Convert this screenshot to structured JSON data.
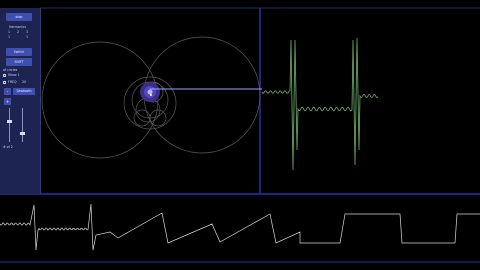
{
  "panel": {
    "top_button": "stop",
    "harmonics_label": "Harmonics",
    "digits_row_1": [
      "1",
      "2",
      "3"
    ],
    "digits_row_2": [
      "1",
      "1"
    ],
    "button_2": "Switch Waveform",
    "button_3": "SHIFT",
    "options_label": "of circles",
    "checkbox_label": "Show 1",
    "freq_label": "FREQ",
    "freq_value": "20",
    "mode_label": "Sawtooth",
    "footer_label": "# of 2",
    "minus_symbol": "-",
    "plus_symbol": "+"
  },
  "colors": {
    "background": "#000000",
    "panel": "#1d2452",
    "accent": "#3e4fb0",
    "circle_stroke": "#5a5a5a",
    "epicycle_fill": "#3d2f8f",
    "trace_green": "#6faf6a",
    "bottom_trace": "#d8d8d8",
    "divider": "#2233aa"
  }
}
